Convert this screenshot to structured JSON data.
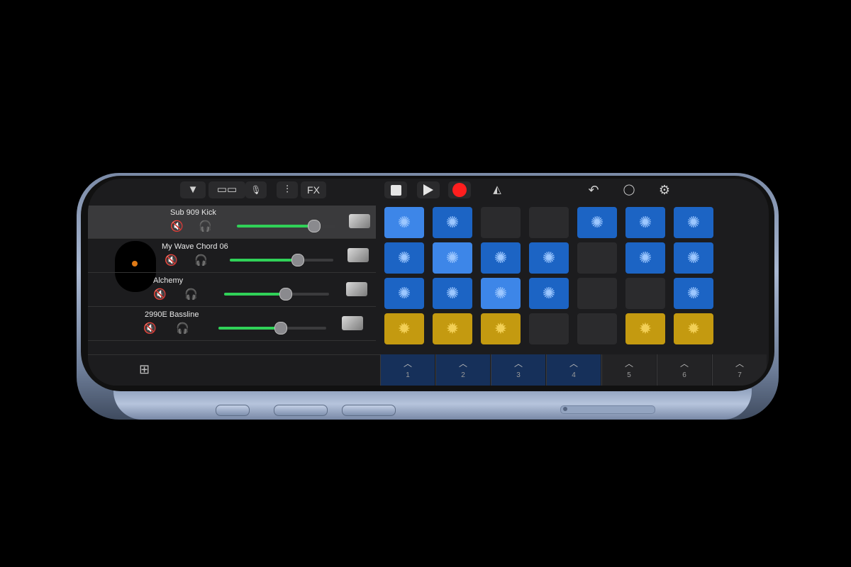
{
  "toolbar": {
    "buttons": [
      {
        "name": "browser-dropdown",
        "icon": "chevron-down-icon",
        "glyph": "▼"
      },
      {
        "name": "view-toggle",
        "icon": "tracks-view-icon",
        "glyph": "▭▭"
      },
      {
        "name": "microphone",
        "icon": "microphone-icon",
        "glyph": "🎙"
      },
      {
        "name": "mixer",
        "icon": "sliders-icon",
        "glyph": "⫶"
      },
      {
        "name": "fx",
        "label": "FX"
      }
    ],
    "transport": {
      "stop": "stop-icon",
      "play": "play-icon",
      "record": "record-icon"
    },
    "right": [
      {
        "name": "metronome",
        "icon": "metronome-icon",
        "glyph": "◭"
      },
      {
        "name": "undo",
        "icon": "undo-icon",
        "glyph": "↶"
      },
      {
        "name": "loop",
        "icon": "loop-icon",
        "glyph": "◯"
      },
      {
        "name": "settings",
        "icon": "gear-icon",
        "glyph": "⚙"
      }
    ]
  },
  "tracks": [
    {
      "name": "Sub 909 Kick",
      "volume": 0.77,
      "selected": true
    },
    {
      "name": "My Wave Chord 06",
      "volume": 0.65,
      "selected": false
    },
    {
      "name": "Alchemy",
      "volume": 0.58,
      "selected": false
    },
    {
      "name": "2990E Bassline",
      "volume": 0.57,
      "selected": false
    }
  ],
  "track_controls": {
    "mute_glyph": "🔇",
    "headphones_glyph": "🎧"
  },
  "grid": {
    "rows": [
      [
        "blue-playing",
        "blue",
        "empty",
        "empty",
        "blue",
        "blue",
        "blue"
      ],
      [
        "blue",
        "blue-playing",
        "blue",
        "blue",
        "empty",
        "blue",
        "blue"
      ],
      [
        "blue",
        "blue",
        "blue-playing",
        "blue",
        "empty",
        "empty",
        "blue"
      ],
      [
        "yellow",
        "yellow-playing",
        "yellow",
        "empty",
        "empty",
        "yellow",
        "yellow"
      ]
    ],
    "glyphs": {
      "blue": "✺",
      "yellow": "✹"
    }
  },
  "scene_triggers": {
    "caret": "︿",
    "numbers": [
      "1",
      "2",
      "3",
      "4",
      "5",
      "6",
      "7"
    ],
    "active": [
      true,
      true,
      true,
      true,
      false,
      false,
      false
    ]
  },
  "bottom_left_icon": "edit-grid-icon",
  "colors": {
    "accent_green": "#30d158",
    "record_red": "#ff1e1e",
    "cell_blue": "#1c64c4",
    "cell_yellow": "#c49a10"
  }
}
